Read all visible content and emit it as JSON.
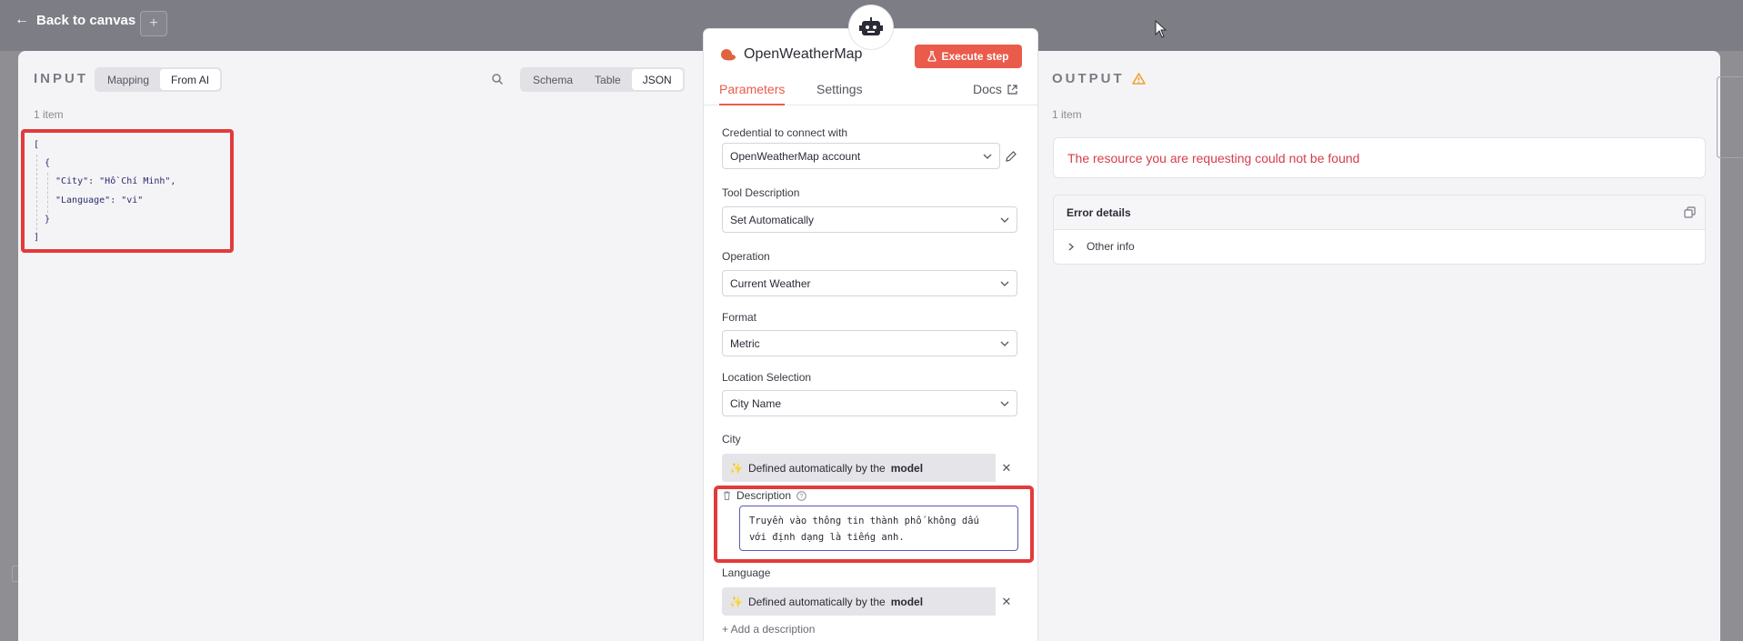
{
  "header": {
    "back_label": "Back to canvas",
    "plus_label": "+"
  },
  "input_panel": {
    "title": "INPUT",
    "mode_options": [
      "Mapping",
      "From AI"
    ],
    "active_mode": "From AI",
    "views": [
      "Schema",
      "Table",
      "JSON"
    ],
    "active_view": "JSON",
    "item_count": "1 item",
    "json_lines": [
      "[",
      "{",
      "\"City\": \"Hồ Chí Minh\",",
      "\"Language\": \"vi\"",
      "}",
      "]"
    ]
  },
  "node": {
    "title": "OpenWeatherMap",
    "execute_label": "Execute step",
    "tabs": [
      "Parameters",
      "Settings"
    ],
    "active_tab": "Parameters",
    "docs_label": "Docs",
    "fields": {
      "credential": {
        "label": "Credential to connect with",
        "value": "OpenWeatherMap account"
      },
      "tool_description": {
        "label": "Tool Description",
        "value": "Set Automatically"
      },
      "operation": {
        "label": "Operation",
        "value": "Current Weather"
      },
      "format": {
        "label": "Format",
        "value": "Metric"
      },
      "location_selection": {
        "label": "Location Selection",
        "value": "City Name"
      },
      "city": {
        "label": "City",
        "value_prefix": "Defined automatically by the",
        "value_bold": "model"
      },
      "description": {
        "label": "Description",
        "value": "Truyền vào thông tin thành phố không dấu\nvới định dạng là tiếng anh."
      },
      "language": {
        "label": "Language",
        "value_prefix": "Defined automatically by the",
        "value_bold": "model"
      }
    },
    "add_description_label": "+ Add a description"
  },
  "output_panel": {
    "title": "OUTPUT",
    "item_count": "1 item",
    "error_message": "The resource you are requesting could not be found",
    "error_details_label": "Error details",
    "other_info_label": "Other info"
  },
  "colors": {
    "accent": "#ea5b4b",
    "error_text": "#d63d4a",
    "highlight_border": "#e23b3b",
    "warning": "#f0a030"
  },
  "icons": [
    "back-arrow-icon",
    "search-icon",
    "robot-icon",
    "cloud-icon",
    "flask-icon",
    "external-link-icon",
    "pencil-icon",
    "chevron-down-icon",
    "sparkle-icon",
    "close-icon",
    "trash-icon",
    "help-icon",
    "warning-icon",
    "copy-icon",
    "chevron-right-icon"
  ]
}
